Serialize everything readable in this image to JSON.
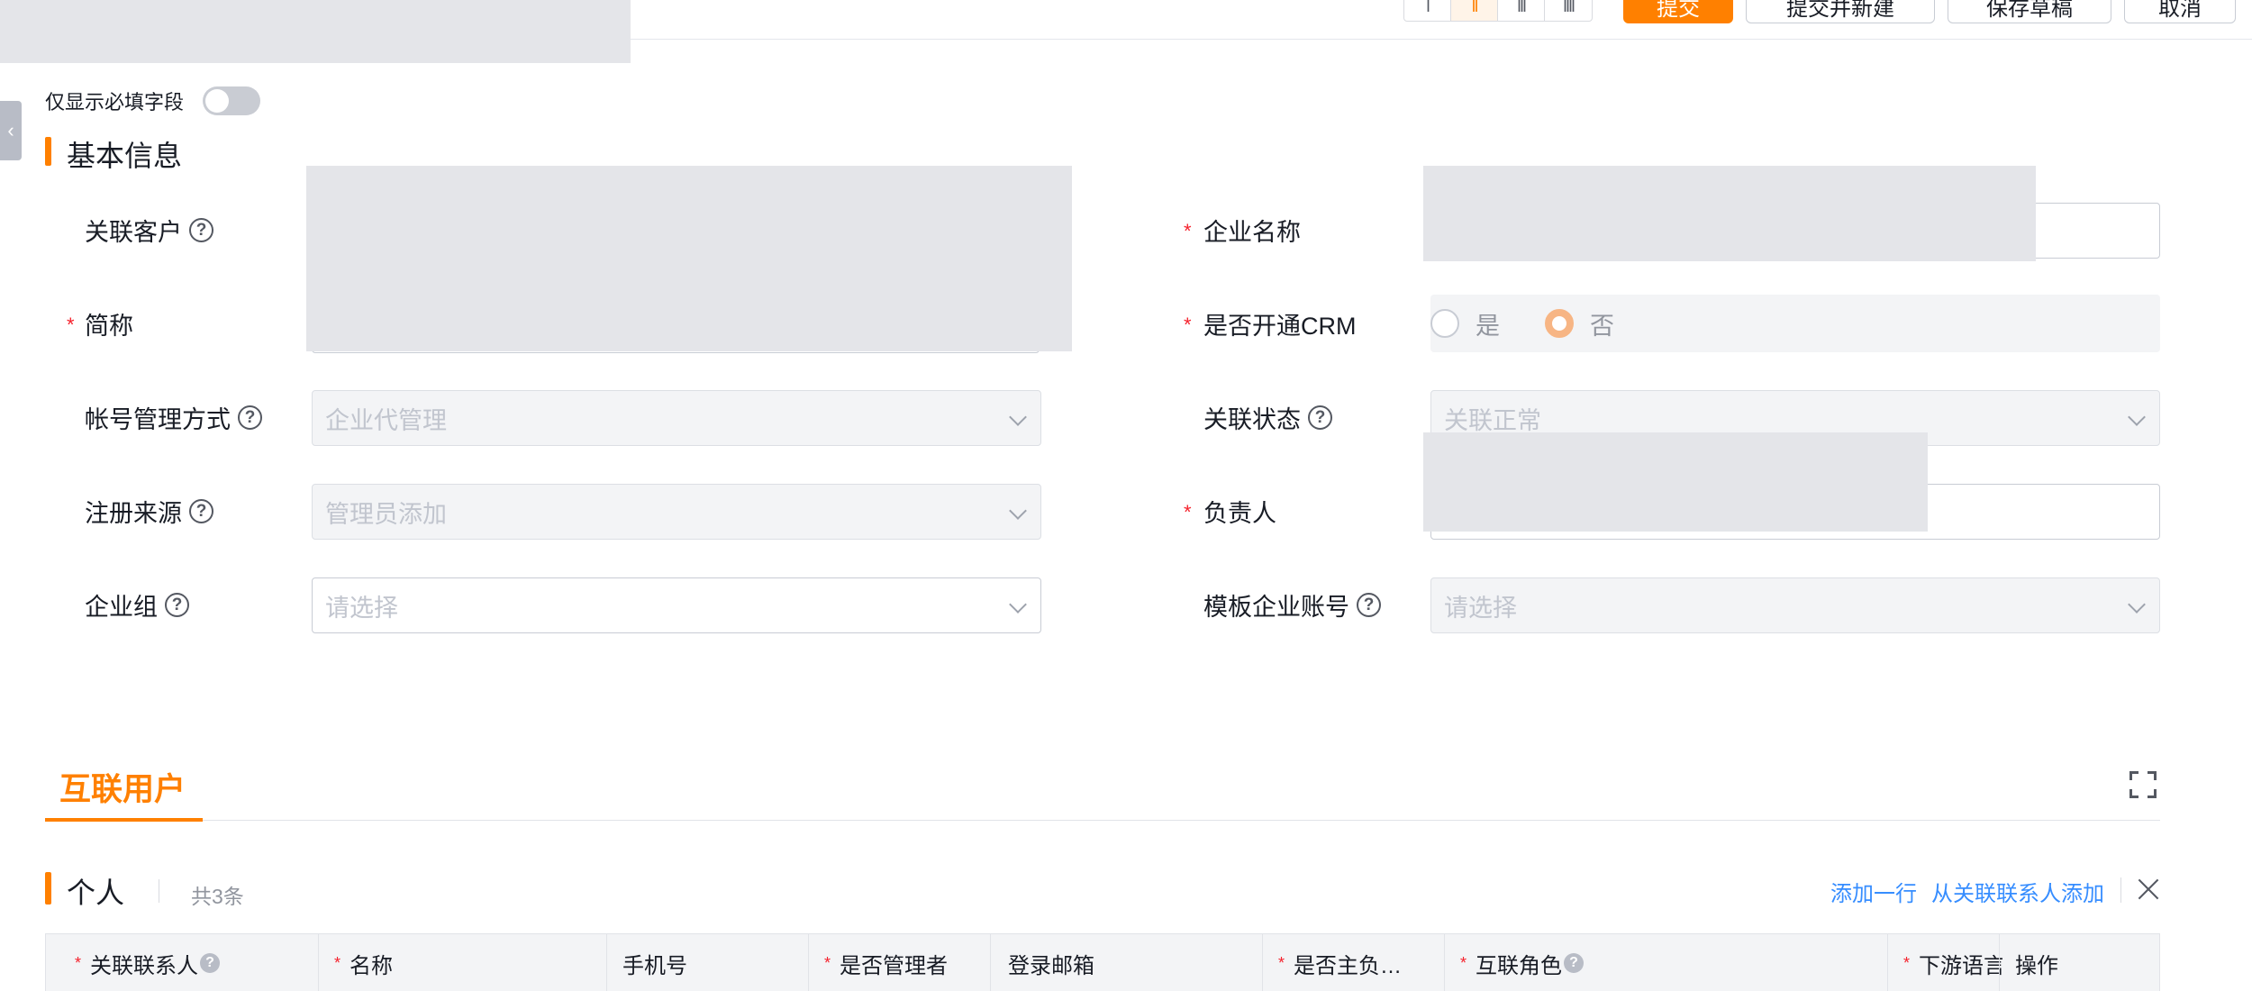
{
  "toolbar": {
    "layout_buttons": [
      "I",
      "II",
      "III",
      "IIII"
    ],
    "active_layout": "II",
    "submit_label": "提交",
    "submit_new_label": "提交并新建",
    "save_draft_label": "保存草稿",
    "cancel_label": "取消"
  },
  "required_toggle": {
    "label": "仅显示必填字段",
    "on": false
  },
  "basic_info": {
    "title": "基本信息",
    "fields": {
      "linked_customer": {
        "label": "关联客户",
        "required": false
      },
      "company_name": {
        "label": "企业名称",
        "required": true
      },
      "short_name": {
        "label": "简称",
        "required": true
      },
      "crm_enabled": {
        "label": "是否开通CRM",
        "required": true,
        "options": [
          "是",
          "否"
        ],
        "selected": "否"
      },
      "account_mgmt": {
        "label": "帐号管理方式",
        "value": "企业代管理"
      },
      "link_status": {
        "label": "关联状态",
        "value": "关联正常"
      },
      "reg_source": {
        "label": "注册来源",
        "value": "管理员添加"
      },
      "owner": {
        "label": "负责人",
        "required": true
      },
      "company_group": {
        "label": "企业组",
        "placeholder": "请选择"
      },
      "template_account": {
        "label": "模板企业账号",
        "placeholder": "请选择"
      }
    }
  },
  "tabs": {
    "active": "互联用户"
  },
  "personal": {
    "title": "个人",
    "count": "共3条",
    "add_row": "添加一行",
    "add_from_contacts": "从关联联系人添加",
    "columns": [
      {
        "label": "关联联系人",
        "required": true,
        "help": true
      },
      {
        "label": "名称",
        "required": true
      },
      {
        "label": "手机号",
        "required": false
      },
      {
        "label": "是否管理者",
        "required": true
      },
      {
        "label": "登录邮箱",
        "required": false
      },
      {
        "label": "是否主负…",
        "required": true
      },
      {
        "label": "互联角色",
        "required": true,
        "help": true
      },
      {
        "label": "下游语言",
        "required": true
      },
      {
        "label": "操作",
        "required": false
      }
    ]
  }
}
